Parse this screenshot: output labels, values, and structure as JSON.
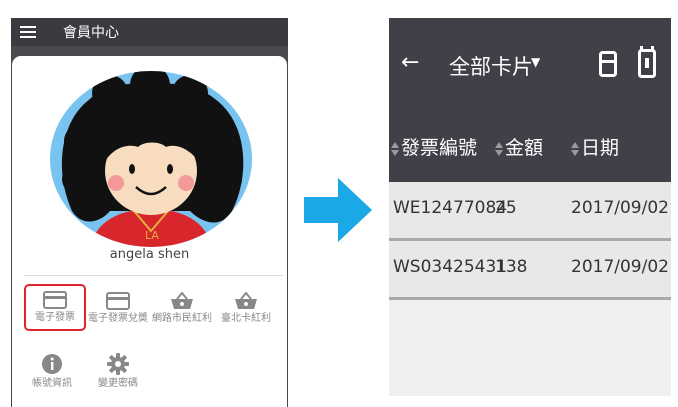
{
  "member_app": {
    "header_title": "會員中心",
    "username": "angela shen",
    "menu": [
      {
        "label": "電子發票",
        "icon": "card-icon",
        "active": true
      },
      {
        "label": "電子發票兌獎",
        "icon": "card-icon",
        "active": false
      },
      {
        "label": "網路市民紅利",
        "icon": "basket-icon",
        "active": false
      },
      {
        "label": "臺北卡紅利",
        "icon": "basket-icon",
        "active": false
      },
      {
        "label": "帳號資訊",
        "icon": "info-icon",
        "active": false
      },
      {
        "label": "變更密碼",
        "icon": "gear-icon",
        "active": false
      }
    ],
    "highlight_color": "#e0242a"
  },
  "arrow_color": "#1aa9e6",
  "invoice_app": {
    "title": "全部卡片",
    "columns": [
      "發票編號",
      "金額",
      "日期"
    ],
    "rows": [
      {
        "number": "WE12477084",
        "amount": "25",
        "date": "2017/09/02"
      },
      {
        "number": "WS03425431",
        "amount": "138",
        "date": "2017/09/02"
      }
    ],
    "header_color": "#414048"
  }
}
